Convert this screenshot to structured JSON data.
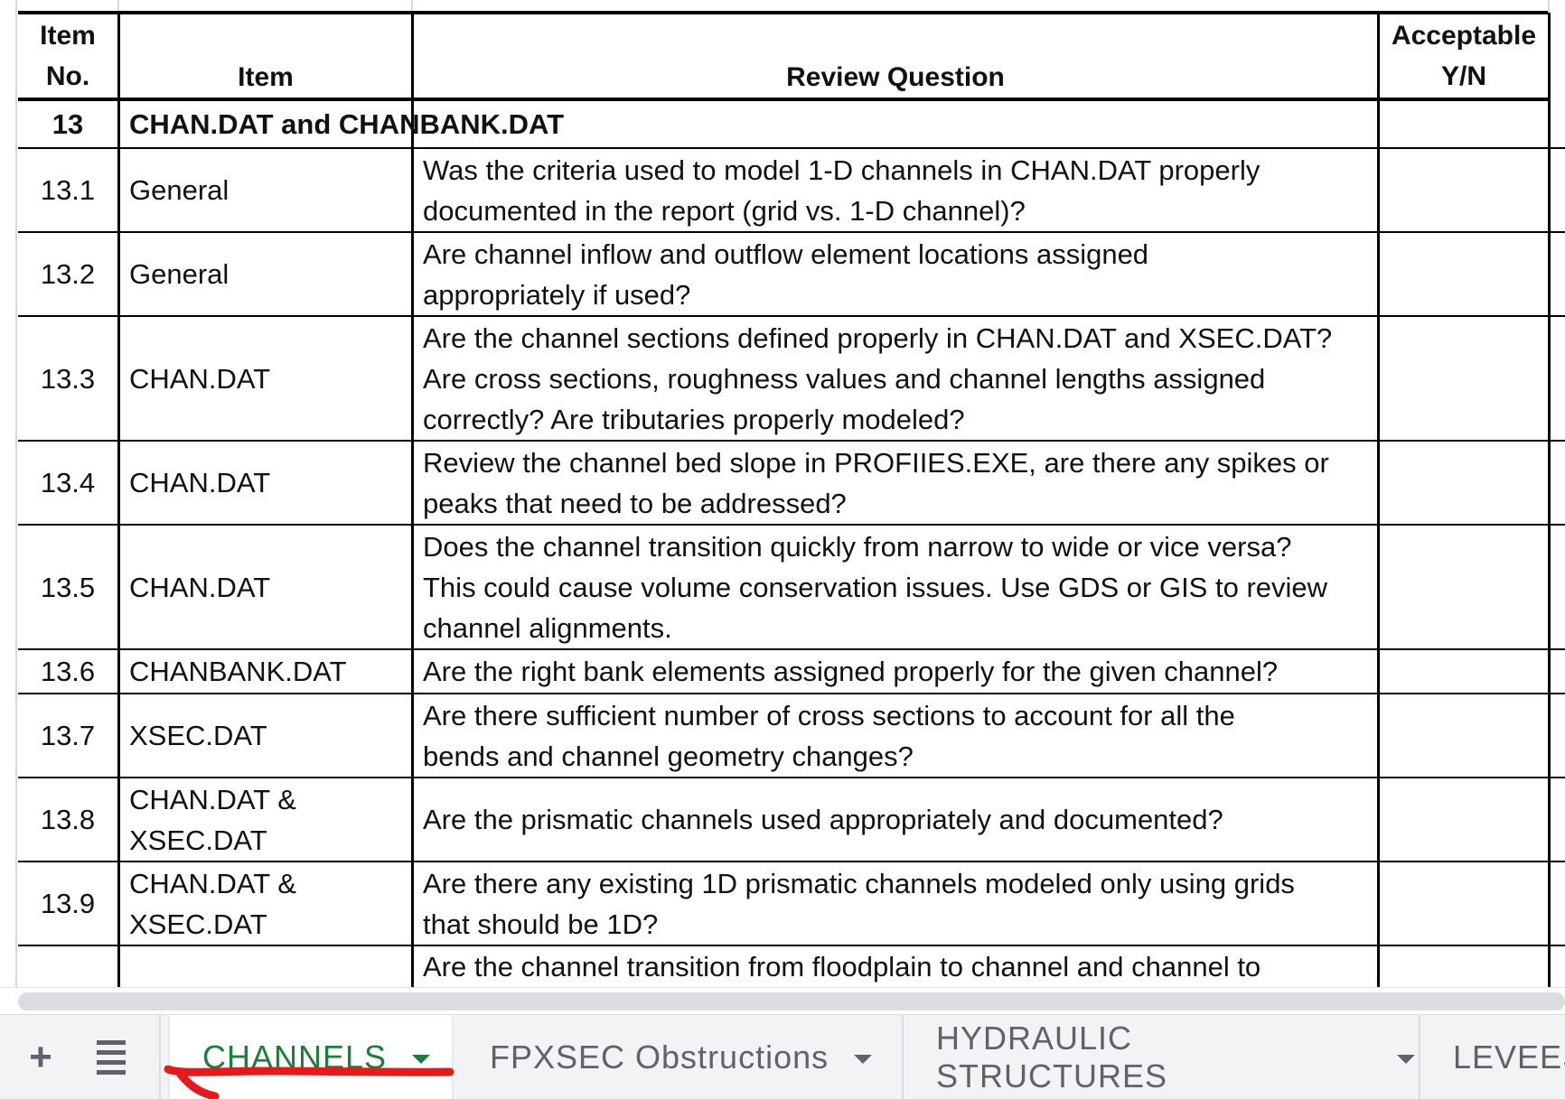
{
  "header": {
    "item_no_line1": "Item",
    "item_no_line2": "No.",
    "item": "Item",
    "review_question": "Review Question",
    "acceptable_line1": "Acceptable",
    "acceptable_line2": "Y/N"
  },
  "section": {
    "number": "13",
    "title": "CHAN.DAT and CHANBANK.DAT"
  },
  "rows": [
    {
      "no": "13.1",
      "item": [
        "General"
      ],
      "question": [
        "Was the criteria used to model 1-D channels in CHAN.DAT properly",
        "documented in the report (grid vs. 1-D channel)?"
      ],
      "acceptable": ""
    },
    {
      "no": "13.2",
      "item": [
        "General"
      ],
      "question": [
        "Are channel inflow and outflow element locations assigned",
        "appropriately if used?"
      ],
      "acceptable": ""
    },
    {
      "no": "13.3",
      "item": [
        "CHAN.DAT"
      ],
      "question": [
        "Are the channel sections defined properly in CHAN.DAT and XSEC.DAT?",
        "Are cross sections, roughness values and channel lengths assigned",
        "correctly? Are tributaries properly modeled?"
      ],
      "acceptable": ""
    },
    {
      "no": "13.4",
      "item": [
        "CHAN.DAT"
      ],
      "question": [
        "Review the channel bed slope in PROFIIES.EXE, are there any spikes or",
        "peaks that need to be addressed?"
      ],
      "acceptable": ""
    },
    {
      "no": "13.5",
      "item": [
        "CHAN.DAT"
      ],
      "question": [
        "Does the channel transition quickly from narrow to wide or vice versa?",
        "This could cause volume conservation issues. Use GDS or GIS to review",
        "channel alignments."
      ],
      "acceptable": ""
    },
    {
      "no": "13.6",
      "item": [
        "CHANBANK.DAT"
      ],
      "question": [
        "Are the right bank elements assigned properly for the given channel?"
      ],
      "acceptable": ""
    },
    {
      "no": "13.7",
      "item": [
        "XSEC.DAT"
      ],
      "question": [
        "Are there sufficient number of cross sections to account for all the",
        "bends and channel geometry changes?"
      ],
      "acceptable": ""
    },
    {
      "no": "13.8",
      "item": [
        "CHAN.DAT &",
        "XSEC.DAT"
      ],
      "question": [
        "Are the prismatic channels used appropriately and documented?"
      ],
      "acceptable": ""
    },
    {
      "no": "13.9",
      "item": [
        "CHAN.DAT &",
        "XSEC.DAT"
      ],
      "question": [
        "Are there any existing 1D prismatic channels modeled only using grids",
        "that should be 1D?"
      ],
      "acceptable": ""
    },
    {
      "no": "",
      "item": [
        ""
      ],
      "question": [
        "Are the channel transition from floodplain to channel and channel to"
      ],
      "acceptable": ""
    }
  ],
  "tabbar": {
    "add_icon": "plus-icon",
    "all_sheets_icon": "menu-icon",
    "tabs": [
      {
        "label": "CHANNELS",
        "active": true
      },
      {
        "label": "FPXSEC Obstructions",
        "active": false
      },
      {
        "label": "HYDRAULIC STRUCTURES",
        "active": false
      },
      {
        "label": "LEVEES",
        "active": false
      }
    ]
  },
  "colors": {
    "active_tab_text": "#188038",
    "tab_text": "#5f6368",
    "tab_bar_bg": "#f1f3f4",
    "annotation": "#e8191b"
  }
}
